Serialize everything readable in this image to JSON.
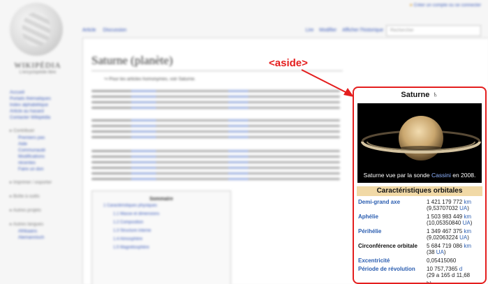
{
  "aside_label": "<aside>",
  "infobox": {
    "title": "Saturne",
    "symbol": "♄",
    "caption_prefix": "Saturne vue par la sonde ",
    "caption_link": "Cassini",
    "caption_suffix": " en 2008.",
    "section_title": "Caractéristiques orbitales",
    "rows": [
      {
        "key": "Demi-grand axe",
        "key_link": true,
        "line1": "1 421 179 772 ",
        "unit1": "km",
        "line2": "(9,53707032 ",
        "unit2": "UA",
        "close2": ")"
      },
      {
        "key": "Aphélie",
        "key_link": true,
        "line1": "1 503 983 449 ",
        "unit1": "km",
        "line2": "(10,05350840 ",
        "unit2": "UA",
        "close2": ")"
      },
      {
        "key": "Périhélie",
        "key_link": true,
        "line1": "1 349 467 375 ",
        "unit1": "km",
        "line2": "(9,02063224 ",
        "unit2": "UA",
        "close2": ")"
      },
      {
        "key": "Circonférence orbitale",
        "key_link": false,
        "line1": "5 684 719 086 ",
        "unit1": "km",
        "line2": "(38 ",
        "unit2": "UA",
        "close2": ")"
      },
      {
        "key": "Excentricité",
        "key_link": true,
        "line1": "0,05415060",
        "unit1": "",
        "line2": "",
        "unit2": "",
        "close2": ""
      },
      {
        "key": "Période de révolution",
        "key_link": true,
        "line1": "10 757,7365 ",
        "unit1": "d",
        "line2": "(29 a 165 d 11,68",
        "unit2": "",
        "close2": ""
      },
      {
        "key": "",
        "key_link": false,
        "line1": "h)",
        "unit1": "",
        "line2": "",
        "unit2": "",
        "close2": ""
      }
    ]
  },
  "colors": {
    "annotation_red": "#e41e1e",
    "section_bg": "#f1d9a6",
    "link_blue": "#2a5db0"
  }
}
